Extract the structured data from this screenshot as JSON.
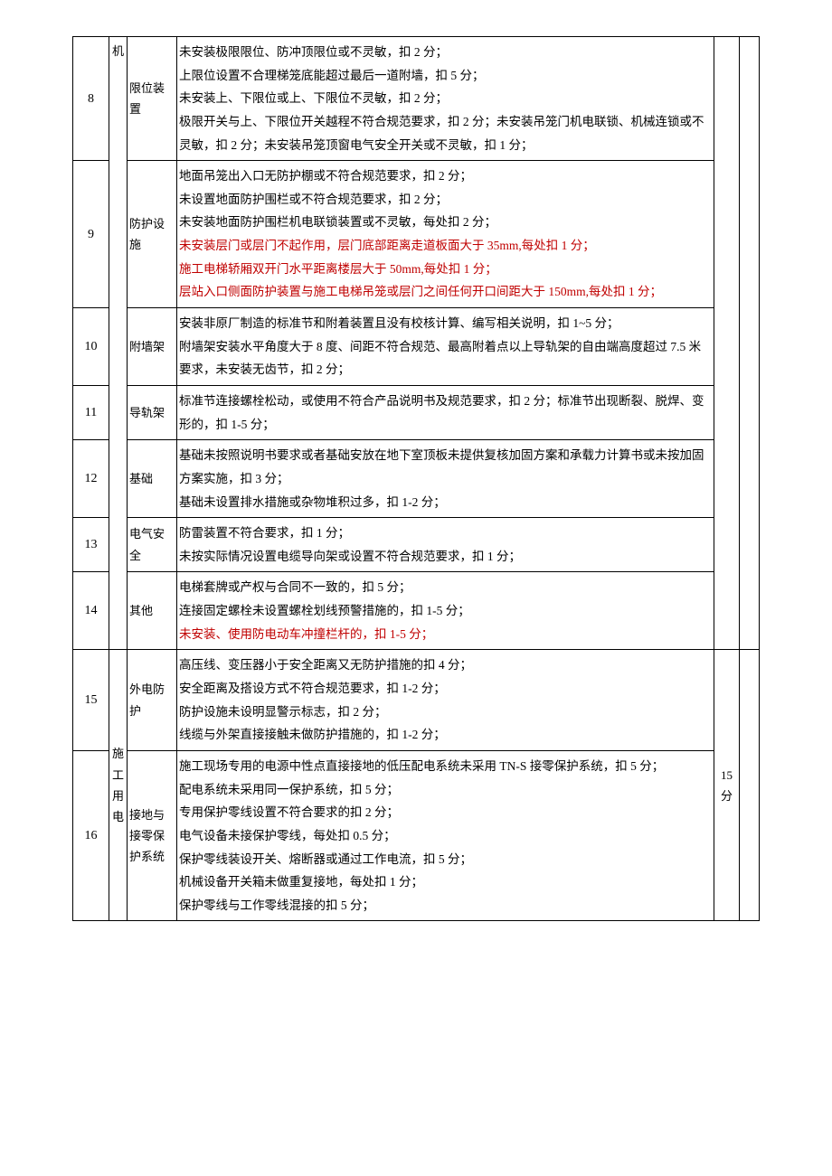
{
  "rows": [
    {
      "num": "8",
      "category": "机",
      "item": "限位装置",
      "content_lines": [
        {
          "text": "未安装极限限位、防冲顶限位或不灵敏，扣 2 分；",
          "highlight": false
        },
        {
          "text": "上限位设置不合理梯笼底能超过最后一道附墙，扣 5 分；",
          "highlight": false
        },
        {
          "text": "未安装上、下限位或上、下限位不灵敏，扣 2 分；",
          "highlight": false
        },
        {
          "text": "极限开关与上、下限位开关越程不符合规范要求，扣 2 分；未安装吊笼门机电联锁、机械连锁或不灵敏，扣 2 分；未安装吊笼顶窗电气安全开关或不灵敏，扣 1 分；",
          "highlight": false
        }
      ]
    },
    {
      "num": "9",
      "item": "防护设施",
      "content_lines": [
        {
          "text": "地面吊笼出入口无防护棚或不符合规范要求，扣 2 分；",
          "highlight": false
        },
        {
          "text": "未设置地面防护围栏或不符合规范要求，扣 2 分；",
          "highlight": false
        },
        {
          "text": "未安装地面防护围栏机电联锁装置或不灵敏，每处扣 2 分；",
          "highlight": false
        },
        {
          "text": "未安装层门或层门不起作用，层门底部距离走道板面大于 35mm,每处扣 1 分；",
          "highlight": true
        },
        {
          "text": "施工电梯轿厢双开门水平距离楼层大于 50mm,每处扣 1 分；",
          "highlight": true
        },
        {
          "text": "层站入口侧面防护装置与施工电梯吊笼或层门之间任何开口间距大于 150mm,每处扣 1 分；",
          "highlight": true
        }
      ]
    },
    {
      "num": "10",
      "item": "附墙架",
      "content_lines": [
        {
          "text": "安装非原厂制造的标准节和附着装置且没有校核计算、编写相关说明，扣 1~5 分；",
          "highlight": false
        },
        {
          "text": "附墙架安装水平角度大于 8 度、间距不符合规范、最高附着点以上导轨架的自由端高度超过 7.5 米要求，未安装无齿节，扣 2 分；",
          "highlight": false
        }
      ]
    },
    {
      "num": "11",
      "item": "导轨架",
      "content_lines": [
        {
          "text": "标准节连接螺栓松动，或使用不符合产品说明书及规范要求，扣 2 分；标准节出现断裂、脱焊、变形的，扣 1-5 分；",
          "highlight": false
        }
      ]
    },
    {
      "num": "12",
      "item": "基础",
      "content_lines": [
        {
          "text": "基础未按照说明书要求或者基础安放在地下室顶板未提供复核加固方案和承载力计算书或未按加固方案实施，扣 3 分；",
          "highlight": false
        },
        {
          "text": "基础未设置排水措施或杂物堆积过多，扣 1-2 分；",
          "highlight": false
        }
      ]
    },
    {
      "num": "13",
      "item": "电气安全",
      "content_lines": [
        {
          "text": "防雷装置不符合要求，扣 1 分；",
          "highlight": false
        },
        {
          "text": "未按实际情况设置电缆导向架或设置不符合规范要求，扣 1 分；",
          "highlight": false
        }
      ]
    },
    {
      "num": "14",
      "item": "其他",
      "content_lines": [
        {
          "text": "电梯套牌或产权与合同不一致的，扣 5 分；",
          "highlight": false
        },
        {
          "text": "连接固定螺栓未设置螺栓划线预警措施的，扣 1-5 分；",
          "highlight": false
        },
        {
          "text": "未安装、使用防电动车冲撞栏杆的，扣 1-5 分；",
          "highlight": true
        }
      ]
    },
    {
      "num": "15",
      "category": "施工用电",
      "item": "外电防护",
      "score": "15分",
      "content_lines": [
        {
          "text": "高压线、变压器小于安全距离又无防护措施的扣 4 分；",
          "highlight": false
        },
        {
          "text": "安全距离及搭设方式不符合规范要求，扣 1-2 分；",
          "highlight": false
        },
        {
          "text": "防护设施未设明显警示标志，扣 2 分；",
          "highlight": false
        },
        {
          "text": "线缆与外架直接接触未做防护措施的，扣 1-2 分；",
          "highlight": false
        }
      ]
    },
    {
      "num": "16",
      "item": "接地与接零保护系统",
      "content_lines": [
        {
          "text": "施工现场专用的电源中性点直接接地的低压配电系统未采用 TN-S 接零保护系统，扣 5 分；",
          "highlight": false
        },
        {
          "text": "配电系统未采用同一保护系统，扣 5 分；",
          "highlight": false
        },
        {
          "text": "专用保护零线设置不符合要求的扣 2 分；",
          "highlight": false
        },
        {
          "text": "电气设备未接保护零线，每处扣 0.5 分；",
          "highlight": false
        },
        {
          "text": "保护零线装设开关、熔断器或通过工作电流，扣 5 分；",
          "highlight": false
        },
        {
          "text": "机械设备开关箱未做重复接地，每处扣 1 分；",
          "highlight": false
        },
        {
          "text": "保护零线与工作零线混接的扣 5 分；",
          "highlight": false
        }
      ]
    }
  ]
}
